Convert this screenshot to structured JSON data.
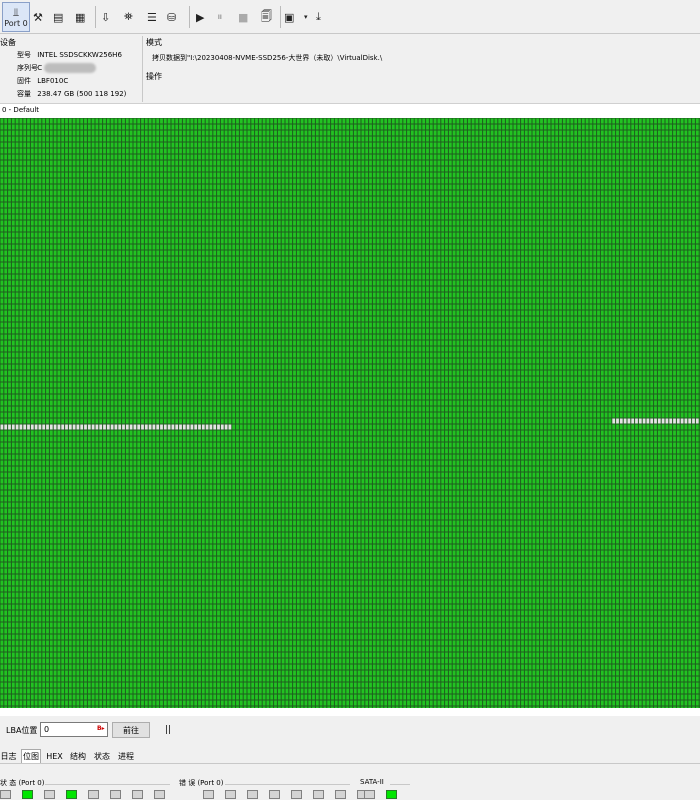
{
  "toolbar": {
    "port_label": "Port 0",
    "icons": [
      "port-icon",
      "tools-icon",
      "disk-icon",
      "chip-icon",
      "plug-icon",
      "binoculars-icon",
      "copy-icon",
      "jar-icon",
      "play-icon",
      "pause-icon",
      "stop-icon",
      "document-icon",
      "monitor-icon",
      "dropdown-icon",
      "step-icon"
    ]
  },
  "device": {
    "title": "设备",
    "model_label": "型号",
    "model_value": "INTEL SSDSCKKW256H6",
    "serial_label": "序列号",
    "serial_value": "C",
    "firmware_label": "固件",
    "firmware_value": "LBF010C",
    "capacity_label": "容量",
    "capacity_value": "238.47 GB (500 118 192)"
  },
  "mode": {
    "title": "模式",
    "text": "拷贝数据到\"I:\\20230408-NVME-SSD256-大世界（未取）\\VirtualDisk.\\"
  },
  "operation": {
    "title": "操作"
  },
  "map": {
    "label": "0 - Default",
    "colors": {
      "good": "#22c322",
      "empty": "#e4e4e4"
    },
    "pending_runs": [
      {
        "row": 51,
        "from_col": 0,
        "to_col": 60
      },
      {
        "row": 50,
        "from_col": 161,
        "to_col": 183
      }
    ]
  },
  "lba": {
    "label": "LBA位置",
    "value": "0",
    "go_label": "前往",
    "pause_label": "||"
  },
  "tabs": [
    "日志",
    "位图",
    "HEX",
    "结构",
    "状态",
    "进程"
  ],
  "status": {
    "state_title": "状 态 (Port 0)",
    "state_leds": [
      false,
      true,
      false,
      true,
      false,
      false,
      false,
      false
    ],
    "error_title": "错 误 (Port 0)",
    "error_leds": [
      false,
      false,
      false,
      false,
      false,
      false,
      false,
      false
    ],
    "sata_title": "SATA-II",
    "sata_leds": [
      false,
      true
    ],
    "colors": {
      "on": "#00e600",
      "off": "#d4d4d4"
    }
  }
}
